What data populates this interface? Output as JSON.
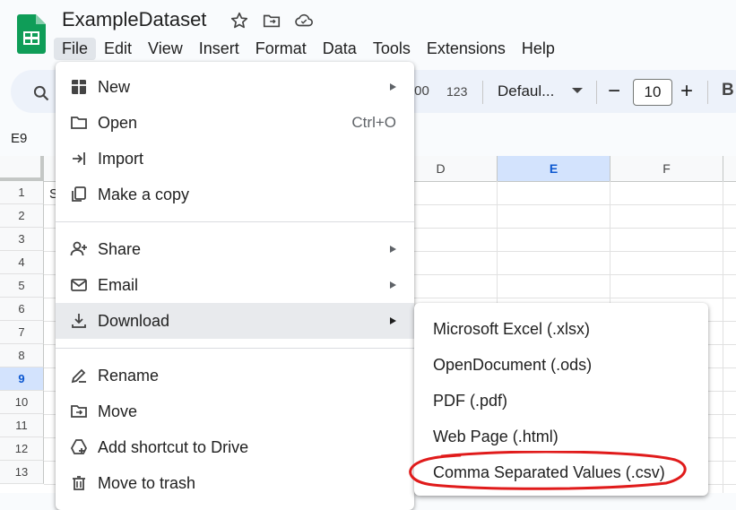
{
  "app": {
    "title": "ExampleDataset",
    "brand_color": "#0f9d58",
    "title_icons": [
      "star-icon",
      "move-to-folder-icon",
      "cloud-status-icon"
    ]
  },
  "menubar": {
    "items": [
      "File",
      "Edit",
      "View",
      "Insert",
      "Format",
      "Data",
      "Tools",
      "Extensions",
      "Help"
    ],
    "active": "File"
  },
  "toolbar": {
    "number_format_1": ".00",
    "number_format_2": "123",
    "font": "Defaul...",
    "font_size": "10",
    "minus": "−",
    "plus": "+",
    "bold": "B"
  },
  "namebox": "E9",
  "grid": {
    "visible_columns": [
      "D",
      "E",
      "F"
    ],
    "selected_column": "E",
    "rows": [
      "1",
      "2",
      "3",
      "4",
      "5",
      "6",
      "7",
      "8",
      "9",
      "10",
      "11",
      "12",
      "13"
    ],
    "selected_row": "9",
    "cell_a1_partial": "S"
  },
  "file_menu": {
    "items": [
      {
        "label": "New",
        "icon": "new-sheet-icon",
        "submenu": true
      },
      {
        "label": "Open",
        "icon": "folder-open-icon",
        "shortcut": "Ctrl+O"
      },
      {
        "label": "Import",
        "icon": "import-icon"
      },
      {
        "label": "Make a copy",
        "icon": "copy-icon"
      },
      {
        "label": "Share",
        "icon": "share-person-icon",
        "submenu": true
      },
      {
        "label": "Email",
        "icon": "email-icon",
        "submenu": true
      },
      {
        "label": "Download",
        "icon": "download-icon",
        "submenu": true,
        "hovered": true
      },
      {
        "label": "Rename",
        "icon": "rename-icon"
      },
      {
        "label": "Move",
        "icon": "move-icon"
      },
      {
        "label": "Add shortcut to Drive",
        "icon": "add-shortcut-icon"
      },
      {
        "label": "Move to trash",
        "icon": "trash-icon"
      }
    ]
  },
  "download_menu": {
    "items": [
      "Microsoft Excel (.xlsx)",
      "OpenDocument (.ods)",
      "PDF (.pdf)",
      "Web Page (.html)",
      "Comma Separated Values (.csv)"
    ],
    "annotated_item": "Comma Separated Values (.csv)",
    "annotation_color": "#e01b1b"
  }
}
